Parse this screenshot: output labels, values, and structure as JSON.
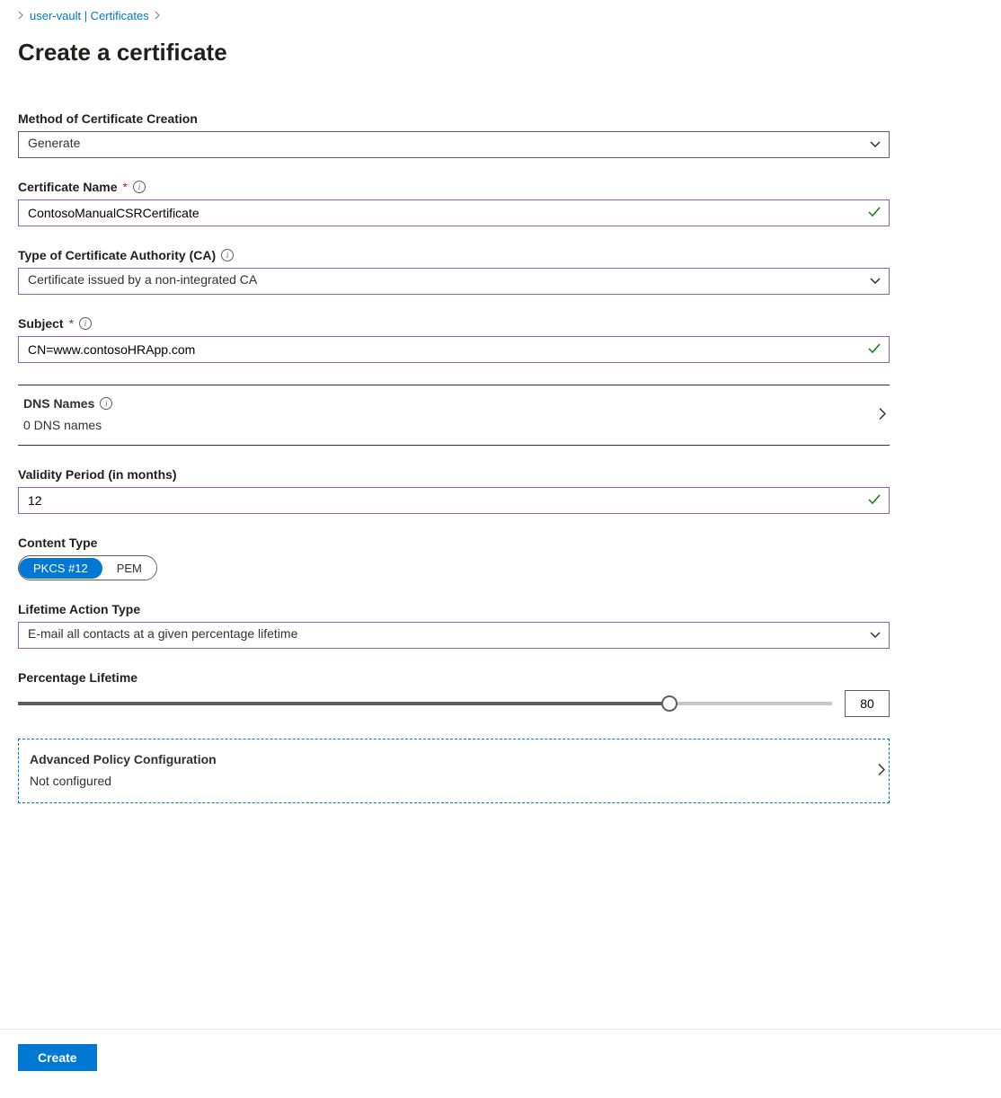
{
  "breadcrumb": {
    "link_text": "user-vault | Certificates"
  },
  "page_title": "Create a certificate",
  "method": {
    "label": "Method of Certificate Creation",
    "value": "Generate"
  },
  "cert_name": {
    "label": "Certificate Name",
    "value": "ContosoManualCSRCertificate"
  },
  "ca_type": {
    "label": "Type of Certificate Authority (CA)",
    "value": "Certificate issued by a non-integrated CA"
  },
  "subject": {
    "label": "Subject",
    "value": "CN=www.contosoHRApp.com"
  },
  "dns_names": {
    "label": "DNS Names",
    "value": "0 DNS names"
  },
  "validity": {
    "label": "Validity Period (in months)",
    "value": "12"
  },
  "content_type": {
    "label": "Content Type",
    "option1": "PKCS #12",
    "option2": "PEM"
  },
  "lifetime_action": {
    "label": "Lifetime Action Type",
    "value": "E-mail all contacts at a given percentage lifetime"
  },
  "percentage_lifetime": {
    "label": "Percentage Lifetime",
    "value": "80",
    "percent": 80
  },
  "advanced_policy": {
    "label": "Advanced Policy Configuration",
    "value": "Not configured"
  },
  "footer": {
    "create_label": "Create"
  }
}
